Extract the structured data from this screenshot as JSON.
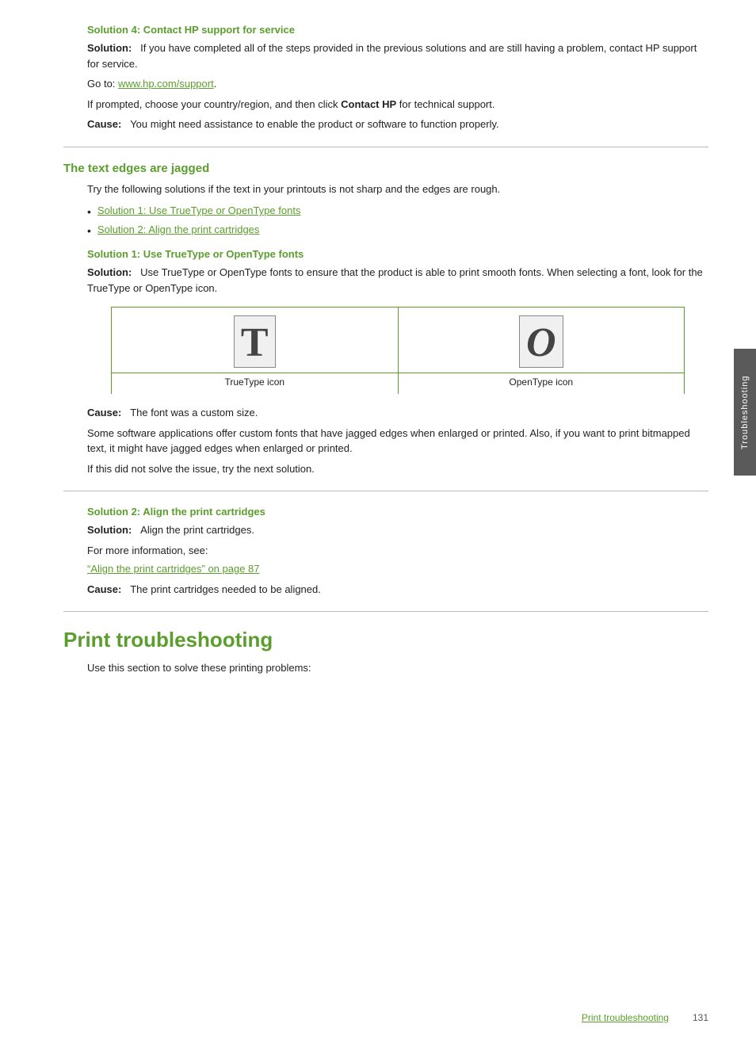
{
  "side_tab": {
    "label": "Troubleshooting"
  },
  "solution4": {
    "heading": "Solution 4: Contact HP support for service",
    "solution_label": "Solution:",
    "solution_text": "If you have completed all of the steps provided in the previous solutions and are still having a problem, contact HP support for service.",
    "goto_prefix": "Go to: ",
    "goto_link": "www.hp.com/support",
    "goto_link_href": "www.hp.com/support",
    "prompted_text": "If prompted, choose your country/region, and then click ",
    "contact_hp_bold": "Contact HP",
    "prompted_suffix": " for technical support.",
    "cause_label": "Cause:",
    "cause_text": "You might need assistance to enable the product or software to function properly."
  },
  "section_jagged": {
    "heading": "The text edges are jagged",
    "intro": "Try the following solutions if the text in your printouts is not sharp and the edges are rough.",
    "bullets": [
      {
        "text": "Solution 1: Use TrueType or OpenType fonts",
        "link": true
      },
      {
        "text": "Solution 2: Align the print cartridges",
        "link": true
      }
    ]
  },
  "solution1": {
    "heading": "Solution 1: Use TrueType or OpenType fonts",
    "solution_label": "Solution:",
    "solution_text": "Use TrueType or OpenType fonts to ensure that the product is able to print smooth fonts. When selecting a font, look for the TrueType or OpenType icon.",
    "truetype_icon_char": "T",
    "opentype_icon_char": "O",
    "truetype_label": "TrueType icon",
    "opentype_label": "OpenType icon",
    "cause_label": "Cause:",
    "cause_text": "The font was a custom size.",
    "detail_text1": "Some software applications offer custom fonts that have jagged edges when enlarged or printed. Also, if you want to print bitmapped text, it might have jagged edges when enlarged or printed.",
    "detail_text2": "If this did not solve the issue, try the next solution."
  },
  "solution2": {
    "heading": "Solution 2: Align the print cartridges",
    "solution_label": "Solution:",
    "solution_text": "Align the print cartridges.",
    "more_info": "For more information, see:",
    "link_text": "“Align the print cartridges” on page 87",
    "cause_label": "Cause:",
    "cause_text": "The print cartridges needed to be aligned."
  },
  "print_troubleshooting": {
    "heading": "Print troubleshooting",
    "intro": "Use this section to solve these printing problems:"
  },
  "footer": {
    "link_text": "Print troubleshooting",
    "page_number": "131"
  }
}
